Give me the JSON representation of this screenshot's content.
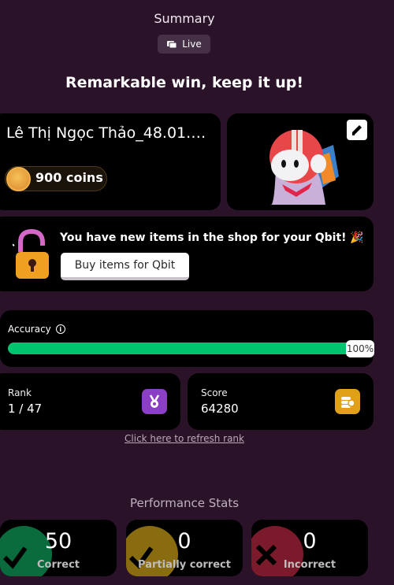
{
  "header": {
    "title": "Summary",
    "live_label": "Live"
  },
  "headline": "Remarkable win, keep it up!",
  "player": {
    "name": "Lê Thị Ngọc Thảo_48.01.10...",
    "coins_label": "900 coins"
  },
  "shop": {
    "message": "You have new items in the shop for your Qbit! 🎉",
    "button_label": "Buy items for Qbit"
  },
  "accuracy": {
    "label": "Accuracy",
    "percent_label": "100%",
    "fill_fraction": 1.0
  },
  "rank": {
    "label": "Rank",
    "value": "1 / 47"
  },
  "score": {
    "label": "Score",
    "value": "64280"
  },
  "refresh_link": "Click here to refresh rank",
  "performance": {
    "title": "Performance Stats",
    "stats": [
      {
        "value": "50",
        "label": "Correct",
        "color": "#0a6b3c"
      },
      {
        "value": "0",
        "label": "Partially correct",
        "color": "#8a6c10"
      },
      {
        "value": "0",
        "label": "Incorrect",
        "color": "#7a1a2a"
      }
    ]
  },
  "colors": {
    "background": "#2a1328",
    "accuracy_bar": "#00c56e",
    "rank_badge": "#8b3fc4",
    "score_badge": "#e0a018"
  }
}
